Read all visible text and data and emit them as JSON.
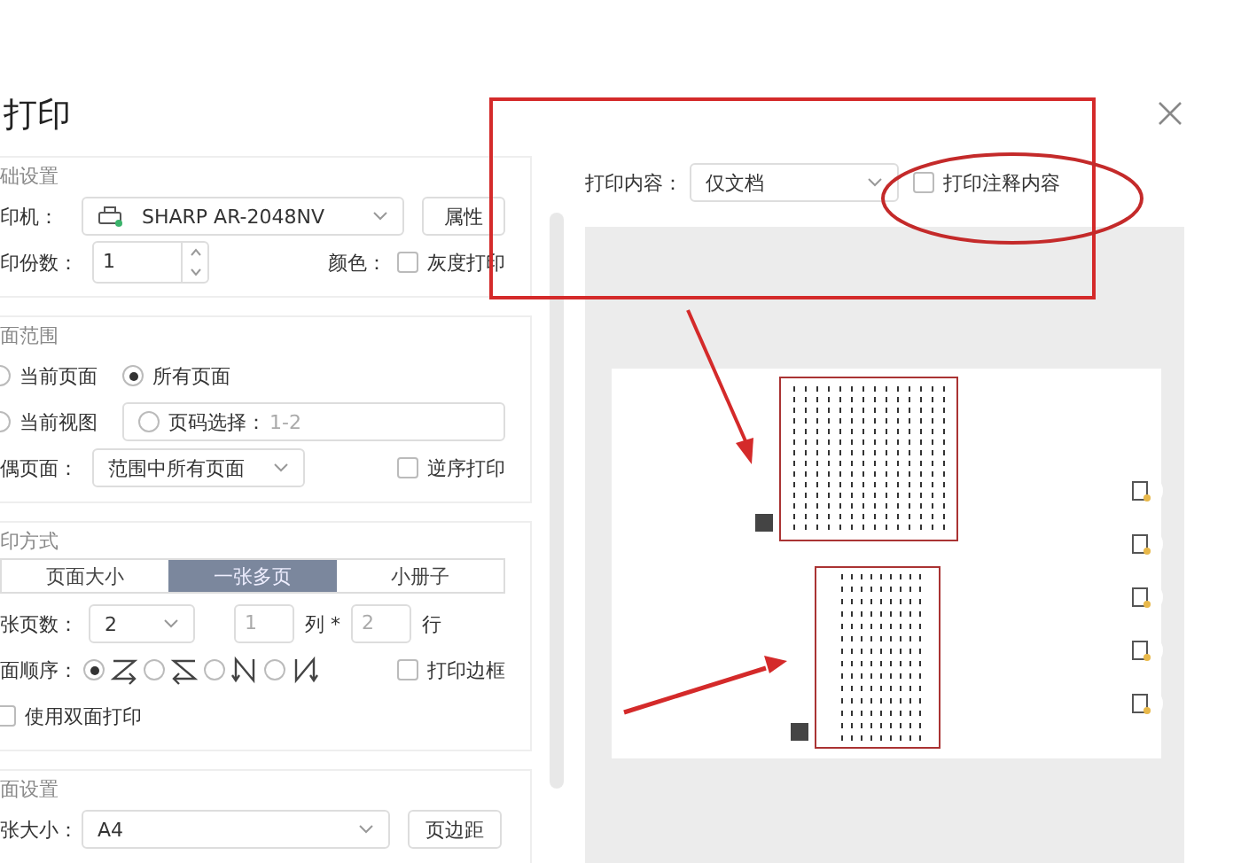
{
  "window": {
    "title": "打印"
  },
  "basic": {
    "title": "础设置",
    "printer_label": "印机：",
    "printer": "SHARP AR-2048NV",
    "properties_button": "属性",
    "copies_label": "印份数：",
    "copies": "1",
    "color_label": "颜色：",
    "grayscale": {
      "label": "灰度打印",
      "checked": false
    }
  },
  "range": {
    "title": "面范围",
    "options": [
      {
        "label": "当前页面",
        "selected": false
      },
      {
        "label": "所有页面",
        "selected": true
      },
      {
        "label": "当前视图",
        "selected": false
      },
      {
        "label": "页码选择：",
        "selected": false
      }
    ],
    "page_field_placeholder": "1-2",
    "odd_even_label": "偶页面：",
    "odd_even": "范围中所有页面",
    "reverse": {
      "label": "逆序打印",
      "checked": false
    }
  },
  "mode": {
    "title": "印方式",
    "tabs": [
      {
        "label": "页面大小",
        "selected": false
      },
      {
        "label": "一张多页",
        "selected": true
      },
      {
        "label": "小册子",
        "selected": false
      }
    ],
    "pages_per_sheet_label": "张页数：",
    "pages_per_sheet": "2",
    "columns": "1",
    "columns_label": "列 *",
    "rows": "2",
    "rows_label": "行",
    "order_label": "面顺序：",
    "orders": [
      {
        "kind": "z",
        "selected": true
      },
      {
        "kind": "z-reverse",
        "selected": false
      },
      {
        "kind": "n",
        "selected": false
      },
      {
        "kind": "n-reverse",
        "selected": false
      }
    ],
    "print_border": {
      "label": "打印边框",
      "checked": false
    },
    "duplex": {
      "label": "使用双面打印",
      "checked": false
    }
  },
  "page_setup": {
    "title": "面设置",
    "paper_label": "张大小：",
    "paper": "A4",
    "margins_button": "页边距"
  },
  "content": {
    "label": "打印内容：",
    "value": "仅文档",
    "annotations": {
      "label": "打印注释内容",
      "checked": false
    }
  }
}
